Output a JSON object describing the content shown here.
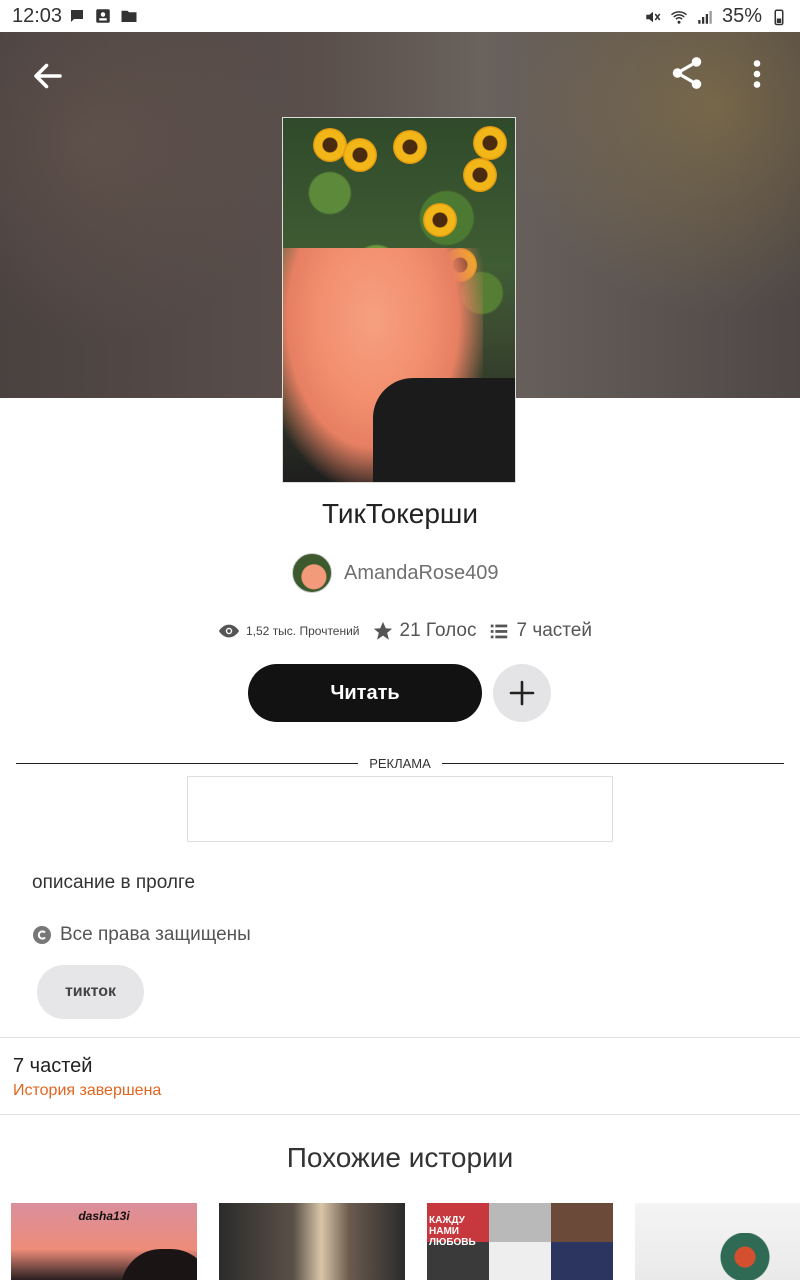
{
  "status_bar": {
    "time": "12:03",
    "battery": "35%",
    "left_icons": [
      "chat-bubble-icon",
      "contact-card-icon",
      "folder-icon"
    ],
    "right_icons": [
      "mute-icon",
      "wifi-icon",
      "signal-icon",
      "battery-icon"
    ]
  },
  "toolbar": {
    "back_icon": "arrow-left-icon",
    "share_icon": "share-icon",
    "more_icon": "more-vertical-icon"
  },
  "story": {
    "title": "ТикТокерши",
    "author": "AmandaRose409",
    "stats": {
      "reads": "1,52 тыс. Прочтений",
      "votes": "21 Голос",
      "parts": "7 частей"
    },
    "read_label": "Читать",
    "add_icon": "plus-icon",
    "ad_label": "РЕКЛАМА",
    "description": "описание в пролге",
    "rights": "Все права защищены",
    "tag": "тикток"
  },
  "parts_section": {
    "count": "7 частей",
    "status": "История завершена"
  },
  "similar": {
    "title": "Похожие истории",
    "thumb1_text": "dasha13i",
    "thumb3_text": "КАЖДУ НАМИ ЛЮБОВЬ"
  },
  "colors": {
    "accent_orange": "#e2661f",
    "read_button_bg": "#121212",
    "add_button_bg": "#e4e4e6",
    "tag_bg": "#e6e6e8"
  }
}
